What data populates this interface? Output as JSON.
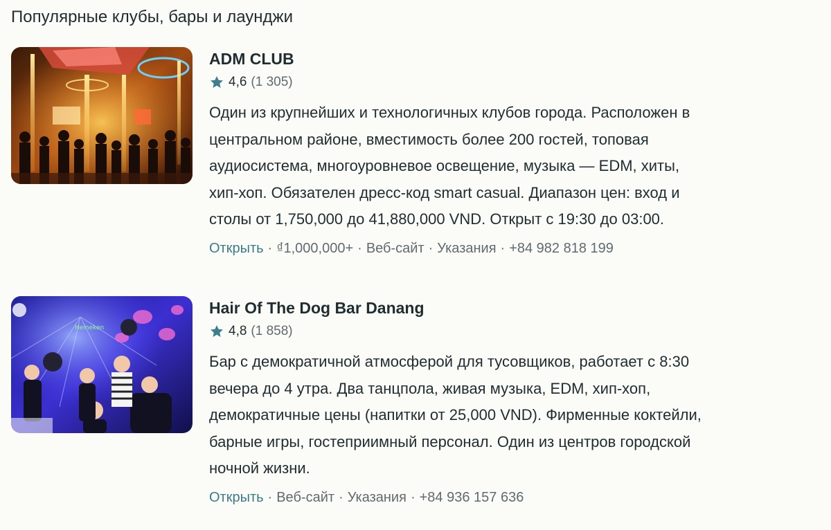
{
  "section_title": "Популярные клубы, бары и лаунджи",
  "colors": {
    "accent": "#3a7b87",
    "star": "#3f7f8d",
    "text": "#1f2d30",
    "muted": "#5f6b6e",
    "background": "#fbfbf7"
  },
  "venues": [
    {
      "name": "ADM CLUB",
      "rating": "4,6",
      "reviews": "(1 305)",
      "description_lines": [
        "Один из крупнейших и технологичных клубов города. Расположен в",
        "центральном районе, вместимость более 200 гостей, топовая",
        "аудиосистема, многоуровневое освещение, музыка — EDM, хиты,",
        "хип-хоп. Обязателен дресс-код smart casual. Диапазон цен: вход и",
        "столы от 1,750,000 до 41,880,000 VND. Открыт с 19:30 до 03:00."
      ],
      "status": "Открыть",
      "price": "₫1,000,000+",
      "website": "Веб-сайт",
      "directions": "Указания",
      "phone": "+84 982 818 199",
      "image_icon": "nightclub-photo"
    },
    {
      "name": "Hair Of The Dog Bar Danang",
      "rating": "4,8",
      "reviews": "(1 858)",
      "description_lines": [
        "Бар с демократичной атмосферой для тусовщиков, работает с 8:30",
        "вечера до 4 утра. Два танцпола, живая музыка, EDM, хип-хоп,",
        "демократичные цены (напитки от 25,000 VND). Фирменные коктейли,",
        "барные игры, гостеприимный персонал. Один из центров городской",
        "ночной жизни."
      ],
      "status": "Открыть",
      "website": "Веб-сайт",
      "directions": "Указания",
      "phone": "+84 936 157 636",
      "image_icon": "bar-party-photo"
    }
  ]
}
